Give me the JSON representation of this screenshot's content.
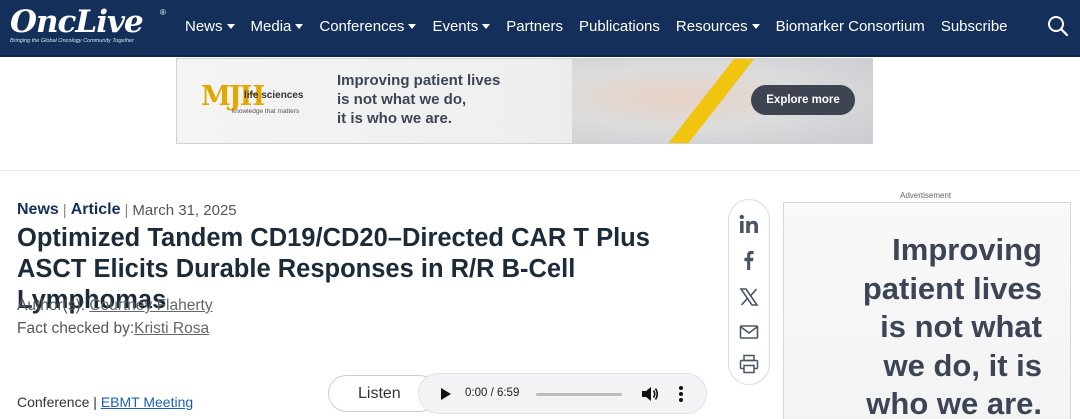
{
  "brand": {
    "name": "OncLive",
    "registered": "®",
    "tagline": "Bringing the Global Oncology Community Together"
  },
  "nav": {
    "items": [
      {
        "label": "News",
        "dropdown": true
      },
      {
        "label": "Media",
        "dropdown": true
      },
      {
        "label": "Conferences",
        "dropdown": true
      },
      {
        "label": "Events",
        "dropdown": true
      },
      {
        "label": "Partners",
        "dropdown": false
      },
      {
        "label": "Publications",
        "dropdown": false
      },
      {
        "label": "Resources",
        "dropdown": true
      },
      {
        "label": "Biomarker Consortium",
        "dropdown": false
      },
      {
        "label": "Subscribe",
        "dropdown": false
      }
    ],
    "search_icon": "search-icon"
  },
  "banner_ad": {
    "logo_mark": "MJH",
    "logo_name": "life sciences",
    "logo_sub": "knowledge that matters",
    "headline_lines": [
      "Improving patient lives",
      "is not what we do,",
      "it is who we are."
    ],
    "cta": "Explore more"
  },
  "article": {
    "category": "News",
    "type": "Article",
    "date": "March 31, 2025",
    "title": "Optimized Tandem CD19/CD20–Directed CAR T Plus ASCT Elicits Durable Responses in R/R B-Cell Lymphomas",
    "author_label": "Author(s):",
    "author": "Courtney Flaherty",
    "fact_check_label": "Fact checked by:",
    "fact_checker": "Kristi Rosa",
    "conference_label": "Conference",
    "conference": "EBMT Meeting"
  },
  "audio": {
    "listen_label": "Listen",
    "time": "0:00 / 6:59"
  },
  "share": {
    "icons": [
      "linkedin-icon",
      "facebook-icon",
      "x-icon",
      "email-icon",
      "print-icon"
    ]
  },
  "side_ad": {
    "label": "Advertisement",
    "text_lines": [
      "Improving",
      "patient lives",
      "is not what",
      "we do, it is",
      "who we are."
    ]
  },
  "colors": {
    "header_bg": "#14305a",
    "accent_link": "#1a5fb4",
    "banner_stripe": "#f1c40f"
  }
}
